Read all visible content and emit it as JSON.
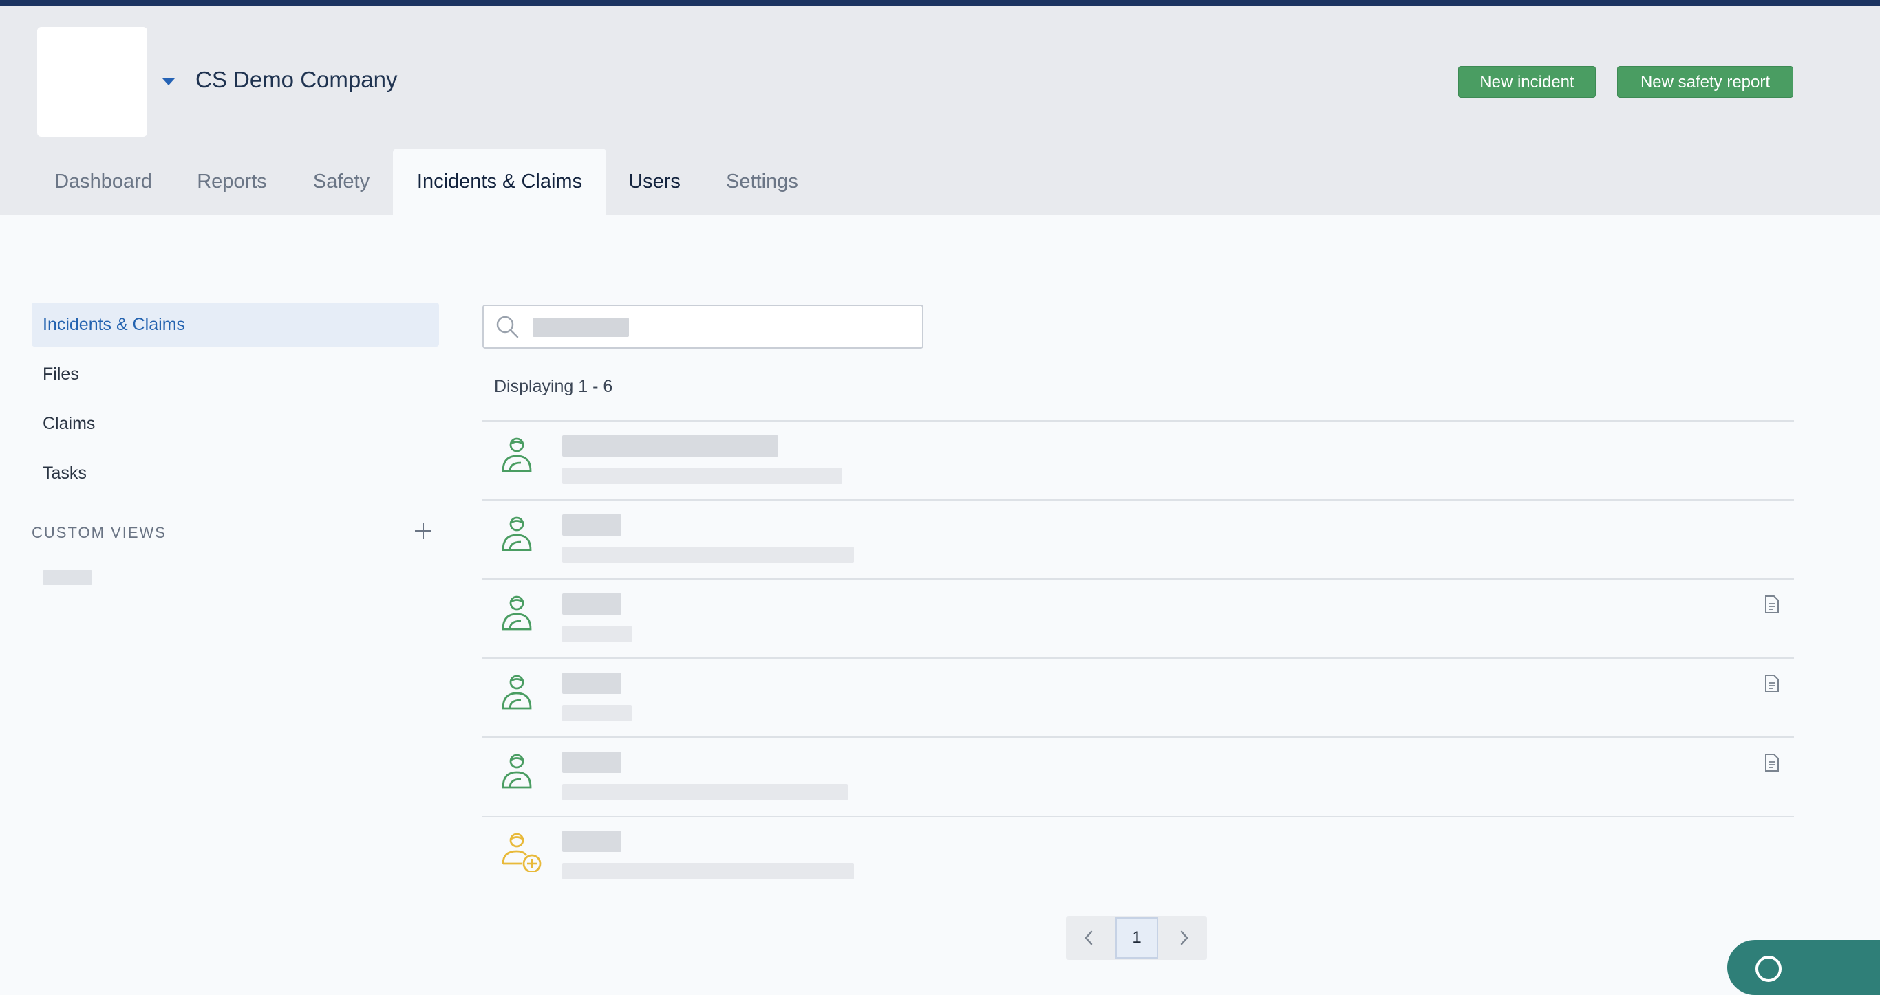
{
  "header": {
    "company_name": "CS Demo Company",
    "new_incident_label": "New incident",
    "new_safety_report_label": "New safety report",
    "accent_color": "#4a9d62"
  },
  "tabs": [
    {
      "label": "Dashboard",
      "active": false
    },
    {
      "label": "Reports",
      "active": false
    },
    {
      "label": "Safety",
      "active": false
    },
    {
      "label": "Incidents & Claims",
      "active": true
    },
    {
      "label": "Users",
      "active": false
    },
    {
      "label": "Settings",
      "active": false
    }
  ],
  "sidebar": {
    "items": [
      {
        "label": "Incidents & Claims",
        "active": true
      },
      {
        "label": "Files",
        "active": false
      },
      {
        "label": "Claims",
        "active": false
      },
      {
        "label": "Tasks",
        "active": false
      }
    ],
    "custom_views_label": "CUSTOM VIEWS"
  },
  "main": {
    "search_icon": "search-icon",
    "display_text": "Displaying 1 - 6",
    "rows": [
      {
        "icon": "injured-worker-icon",
        "icon_color": "#4a9d62",
        "has_document": false
      },
      {
        "icon": "injured-worker-icon",
        "icon_color": "#4a9d62",
        "has_document": false
      },
      {
        "icon": "injured-worker-icon",
        "icon_color": "#4a9d62",
        "has_document": true
      },
      {
        "icon": "injured-worker-icon",
        "icon_color": "#4a9d62",
        "has_document": true
      },
      {
        "icon": "injured-worker-icon",
        "icon_color": "#4a9d62",
        "has_document": true
      },
      {
        "icon": "injured-worker-plus-icon",
        "icon_color": "#e8b93a",
        "has_document": false
      }
    ]
  },
  "pagination": {
    "current_page": "1"
  }
}
